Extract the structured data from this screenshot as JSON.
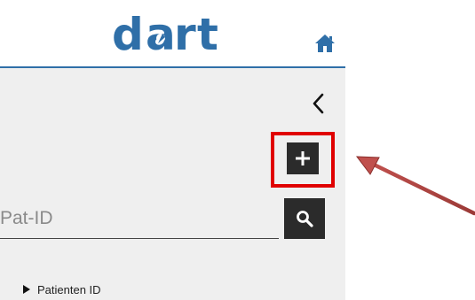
{
  "header": {
    "logo_text": "dart",
    "logo_icon": "dart-logo",
    "home_icon": "home-icon",
    "accent_color": "#2f6fa8"
  },
  "sidebar": {
    "collapse_icon": "chevron-left-icon",
    "add_icon": "plus-icon",
    "add_highlight_color": "#e00000",
    "search": {
      "placeholder": "Pat-ID",
      "value": "",
      "button_icon": "search-icon"
    },
    "tree": {
      "items": [
        {
          "label": "Patienten ID",
          "icon": "caret-right-icon",
          "expanded": false
        }
      ]
    }
  },
  "annotation": {
    "arrow_color": "#c0504d"
  }
}
